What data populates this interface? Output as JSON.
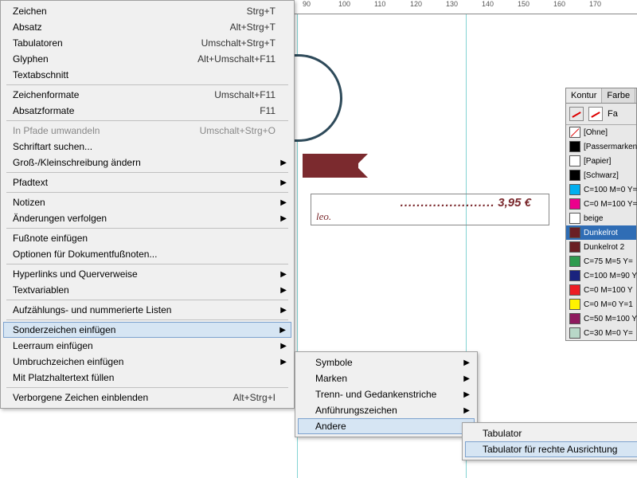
{
  "ruler": {
    "marks": [
      "90",
      "100",
      "110",
      "120",
      "130",
      "140",
      "150",
      "160",
      "170"
    ]
  },
  "menu": {
    "items": [
      {
        "label": "Zeichen",
        "sc": "Strg+T"
      },
      {
        "label": "Absatz",
        "sc": "Alt+Strg+T"
      },
      {
        "label": "Tabulatoren",
        "sc": "Umschalt+Strg+T"
      },
      {
        "label": "Glyphen",
        "sc": "Alt+Umschalt+F11"
      },
      {
        "label": "Textabschnitt"
      },
      "sep",
      {
        "label": "Zeichenformate",
        "sc": "Umschalt+F11"
      },
      {
        "label": "Absatzformate",
        "sc": "F11"
      },
      "sep",
      {
        "label": "In Pfade umwandeln",
        "sc": "Umschalt+Strg+O",
        "disabled": true
      },
      {
        "label": "Schriftart suchen..."
      },
      {
        "label": "Groß-/Kleinschreibung ändern",
        "sub": true
      },
      "sep",
      {
        "label": "Pfadtext",
        "sub": true
      },
      "sep",
      {
        "label": "Notizen",
        "sub": true
      },
      {
        "label": "Änderungen verfolgen",
        "sub": true
      },
      "sep",
      {
        "label": "Fußnote einfügen"
      },
      {
        "label": "Optionen für Dokumentfußnoten..."
      },
      "sep",
      {
        "label": "Hyperlinks und Querverweise",
        "sub": true
      },
      {
        "label": "Textvariablen",
        "sub": true
      },
      "sep",
      {
        "label": "Aufzählungs- und nummerierte Listen",
        "sub": true
      },
      "sep",
      {
        "label": "Sonderzeichen einfügen",
        "sub": true,
        "hov": true
      },
      {
        "label": "Leerraum einfügen",
        "sub": true
      },
      {
        "label": "Umbruchzeichen einfügen",
        "sub": true
      },
      {
        "label": "Mit Platzhaltertext füllen"
      },
      "sep",
      {
        "label": "Verborgene Zeichen einblenden",
        "sc": "Alt+Strg+I"
      }
    ]
  },
  "submenu": {
    "items": [
      {
        "label": "Symbole",
        "sub": true
      },
      {
        "label": "Marken",
        "sub": true
      },
      {
        "label": "Trenn- und Gedankenstriche",
        "sub": true
      },
      {
        "label": "Anführungszeichen",
        "sub": true
      },
      {
        "label": "Andere",
        "sub": true,
        "hov": true
      }
    ]
  },
  "submenu3": {
    "items": [
      {
        "label": "Tabulator"
      },
      {
        "label": "Tabulator für rechte Ausrichtung",
        "hov": true
      }
    ]
  },
  "text": {
    "price": "3,95 €",
    "dots": ".......................",
    "tail": "leo."
  },
  "swatches": {
    "tabs": [
      "Kontur",
      "Farbe"
    ],
    "fa": "Fa",
    "list": [
      {
        "name": "[Ohne]",
        "color": "none"
      },
      {
        "name": "[Passermarken]",
        "color": "#000"
      },
      {
        "name": "[Papier]",
        "color": "#fff"
      },
      {
        "name": "[Schwarz]",
        "color": "#000"
      },
      {
        "name": "C=100 M=0 Y=",
        "color": "#00aeef"
      },
      {
        "name": "C=0 M=100 Y=",
        "color": "#ec008c"
      },
      {
        "name": "beige",
        "color": "#fff"
      },
      {
        "name": "Dunkelrot",
        "color": "#6a1f24",
        "sel": true
      },
      {
        "name": "Dunkelrot 2",
        "color": "#6a1f24"
      },
      {
        "name": "C=75 M=5 Y=",
        "color": "#2e9b4f"
      },
      {
        "name": "C=100 M=90 Y",
        "color": "#1a237e"
      },
      {
        "name": "C=0 M=100 Y",
        "color": "#ed1c24"
      },
      {
        "name": "C=0 M=0 Y=1",
        "color": "#fff200"
      },
      {
        "name": "C=50 M=100 Y",
        "color": "#8e1a5e"
      },
      {
        "name": "C=30 M=0 Y="
      }
    ]
  }
}
